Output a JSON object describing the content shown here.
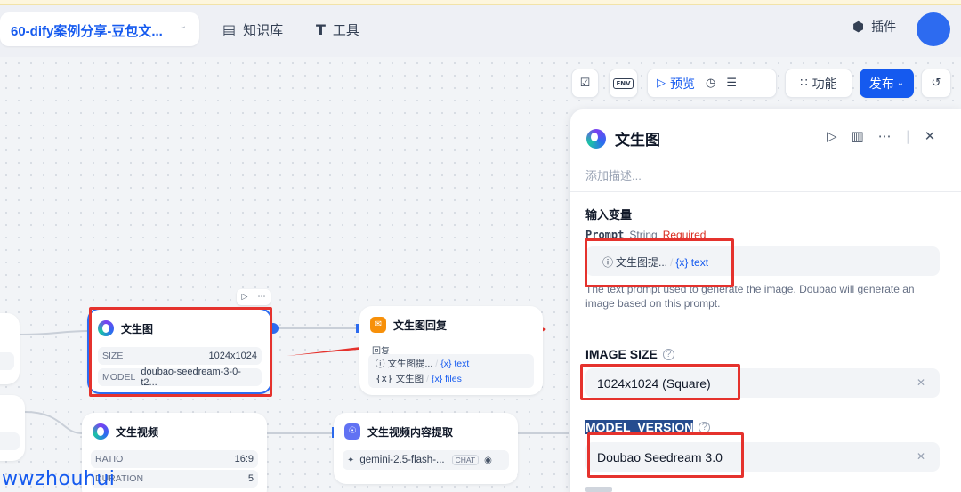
{
  "topbar": {
    "app_name": "60-dify案例分享-豆包文...",
    "nav": [
      {
        "icon": "book-icon",
        "label": "知识库"
      },
      {
        "icon": "tool-icon",
        "label": "工具"
      }
    ],
    "plugin_label": "插件"
  },
  "toolbar": {
    "preview_label": "预览",
    "features_label": "功能",
    "publish_label": "发布",
    "env_label": "ENV"
  },
  "nodes": {
    "wenshengtu": {
      "title": "文生图",
      "rows": [
        {
          "key": "SIZE",
          "value": "1024x1024"
        },
        {
          "key": "MODEL",
          "value": "doubao-seedream-3-0-t2..."
        }
      ]
    },
    "reply": {
      "title": "文生图回复",
      "label": "回复",
      "lines": [
        {
          "src": "文生图提...",
          "var": "{x} text"
        },
        {
          "src": "文生图",
          "var": "{x} files"
        }
      ]
    },
    "video": {
      "title": "文生视频",
      "rows": [
        {
          "key": "RATIO",
          "value": "16:9"
        },
        {
          "key": "DURATION",
          "value": "5"
        }
      ]
    },
    "extract": {
      "title": "文生视频内容提取",
      "model": "gemini-2.5-flash-...",
      "badge": "CHAT"
    }
  },
  "panel": {
    "title": "文生图",
    "desc_placeholder": "添加描述...",
    "input_section": "输入变量",
    "prompt": {
      "name": "Prompt",
      "type": "String",
      "required": "Required",
      "chip_src": "文生图提...",
      "chip_var": "{x} text",
      "help": "The text prompt used to generate the image. Doubao will generate an image based on this prompt."
    },
    "image_size": {
      "label": "IMAGE SIZE",
      "value": "1024x1024 (Square)"
    },
    "model_version": {
      "label": "MODEL_VERSION",
      "value": "Doubao Seedream 3.0"
    }
  },
  "watermark": "wwzhouhui",
  "colors": {
    "accent": "#155aef",
    "annotation_red": "#e5322d"
  }
}
